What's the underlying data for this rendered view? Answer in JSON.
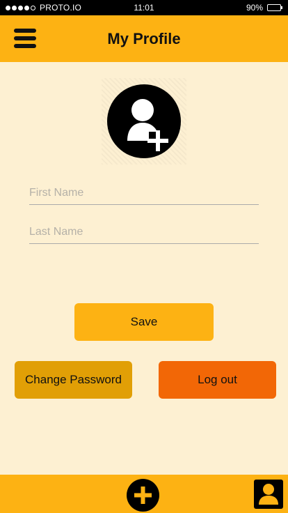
{
  "status_bar": {
    "carrier": "PROTO.IO",
    "time": "11:01",
    "battery": "90%",
    "battery_level": 0.9,
    "signal_filled": 4,
    "signal_total": 5
  },
  "header": {
    "title": "My Profile",
    "menu_icon": "hamburger-menu-icon"
  },
  "avatar": {
    "icon": "add-user-icon"
  },
  "form": {
    "first_name": {
      "value": "",
      "placeholder": "First Name"
    },
    "last_name": {
      "value": "",
      "placeholder": "Last Name"
    }
  },
  "buttons": {
    "save": "Save",
    "change_password": "Change Password",
    "logout": "Log out"
  },
  "bottom_bar": {
    "add_icon": "plus-icon",
    "profile_icon": "profile-icon"
  },
  "colors": {
    "accent": "#fdb213",
    "background": "#fdf0d2",
    "change_password": "#e19f06",
    "logout": "#f26706"
  }
}
